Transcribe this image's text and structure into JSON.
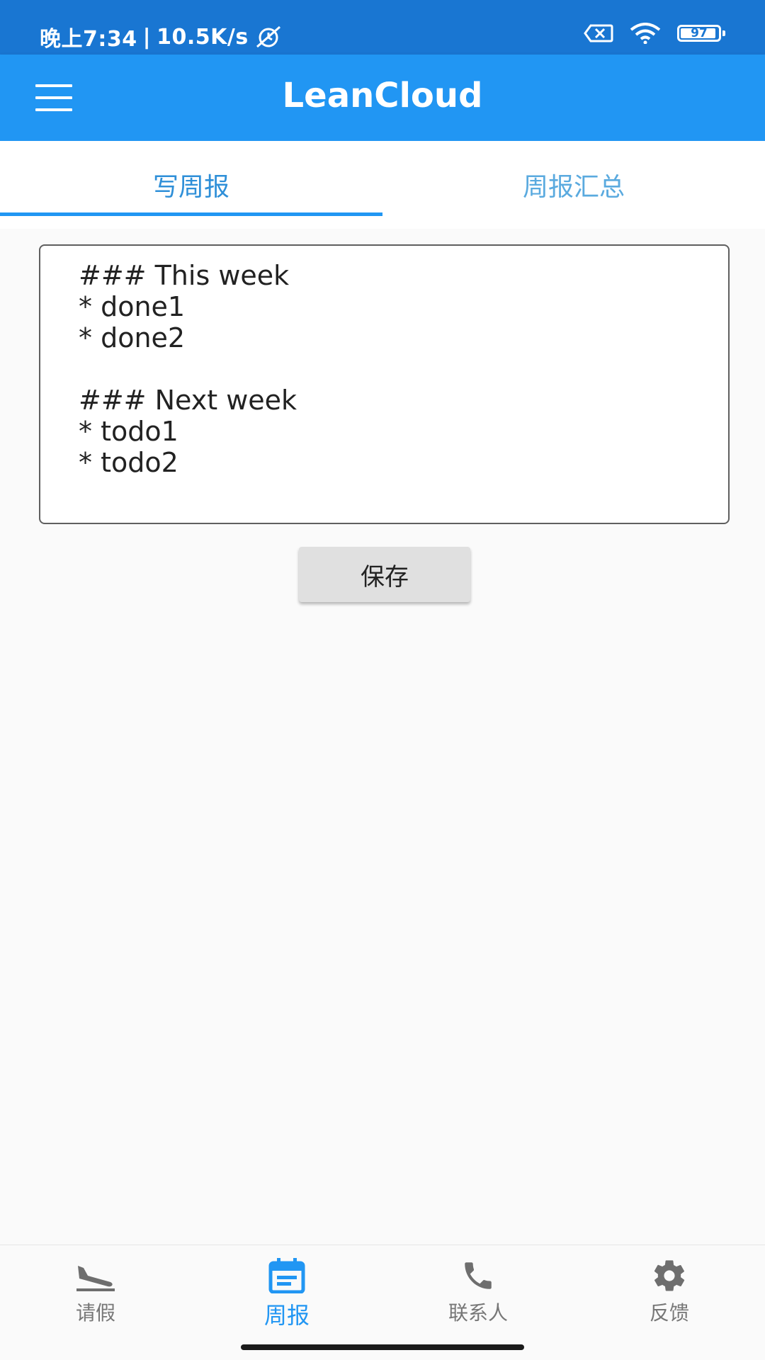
{
  "status_bar": {
    "time": "晚上7:34",
    "network_speed": "10.5K/s",
    "battery_level": "97"
  },
  "app_bar": {
    "title": "LeanCloud"
  },
  "tabs": [
    {
      "label": "写周报",
      "selected": true
    },
    {
      "label": "周报汇总",
      "selected": false
    }
  ],
  "editor": {
    "value": "### This week\n* done1\n* done2\n\n### Next week\n* todo1\n* todo2"
  },
  "save_button": {
    "label": "保存"
  },
  "bottom_nav": [
    {
      "label": "请假",
      "icon": "flight-land-icon",
      "active": false
    },
    {
      "label": "周报",
      "icon": "calendar-icon",
      "active": true
    },
    {
      "label": "联系人",
      "icon": "phone-icon",
      "active": false
    },
    {
      "label": "反馈",
      "icon": "gear-icon",
      "active": false
    }
  ],
  "colors": {
    "status_bar": "#1976d2",
    "app_bar": "#2196f3",
    "accent": "#2196f3",
    "inactive": "#777777"
  }
}
